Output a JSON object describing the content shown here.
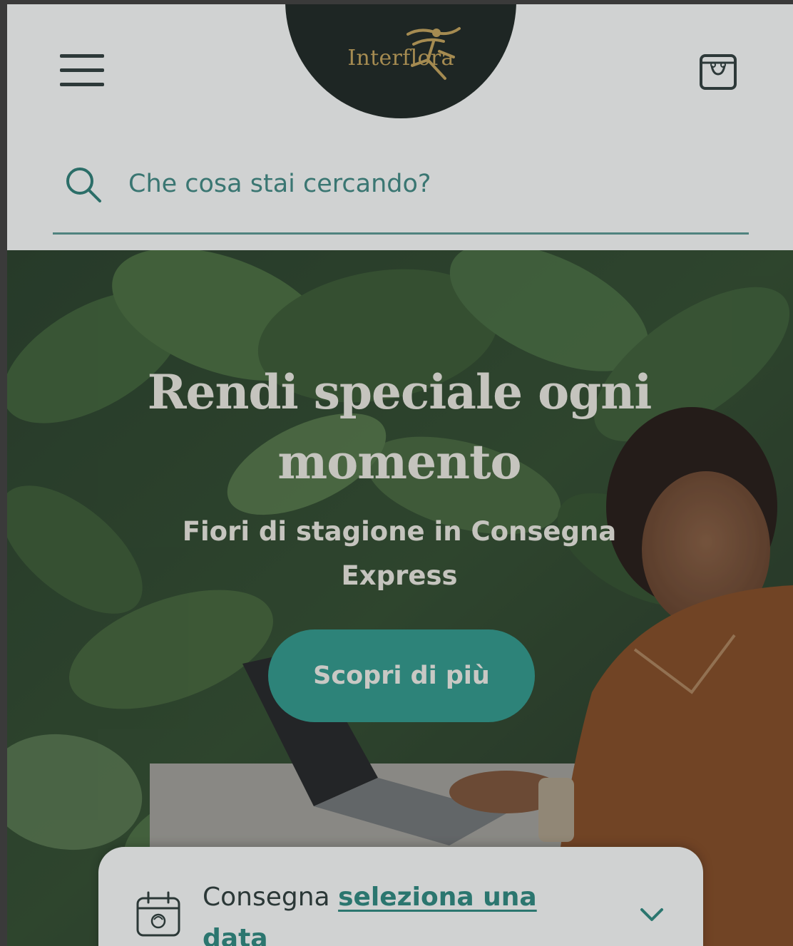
{
  "header": {
    "brand": "Interflora",
    "menu_icon": "hamburger-menu-icon",
    "cart_icon": "shopping-bag-icon"
  },
  "search": {
    "placeholder": "Che cosa stai cercando?",
    "icon": "search-icon"
  },
  "hero": {
    "title": "Rendi speciale ogni momento",
    "subtitle": "Fiori di stagione in Consegna Express",
    "cta_label": "Scopri di più"
  },
  "delivery": {
    "prefix": "Consegna",
    "link": "seleziona una data",
    "icon": "calendar-icon",
    "chevron_icon": "chevron-down-icon"
  },
  "colors": {
    "accent": "#2f9a8e",
    "logo_bg": "#1c2320",
    "logo_gold": "#c8a55a",
    "search_line": "#5b9a95",
    "text_dark": "#2c3a39"
  }
}
